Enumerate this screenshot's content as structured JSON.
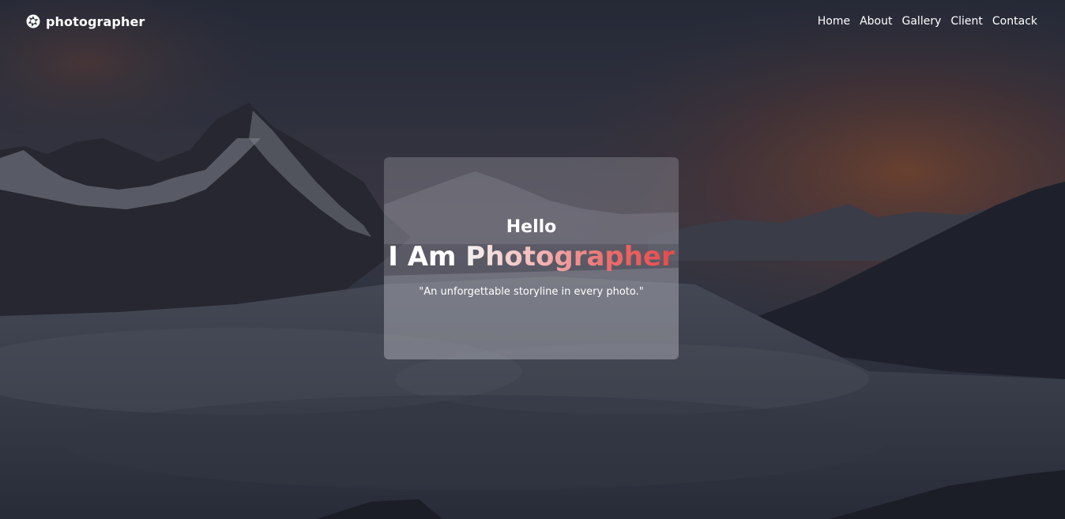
{
  "nav": {
    "brand": "photographer",
    "brand_icon": "camera-aperture-icon",
    "links": [
      {
        "label": "Home"
      },
      {
        "label": "About"
      },
      {
        "label": "Gallery"
      },
      {
        "label": "Client"
      },
      {
        "label": "Contack"
      }
    ]
  },
  "hero": {
    "greeting": "Hello",
    "headline_lead": "I Am ",
    "headline_highlight": "Photographer",
    "tagline": "\"An unforgettable storyline in every photo.\""
  },
  "colors": {
    "accent": "#e84a4a",
    "overlay": "#1c202c",
    "text": "#ffffff"
  }
}
